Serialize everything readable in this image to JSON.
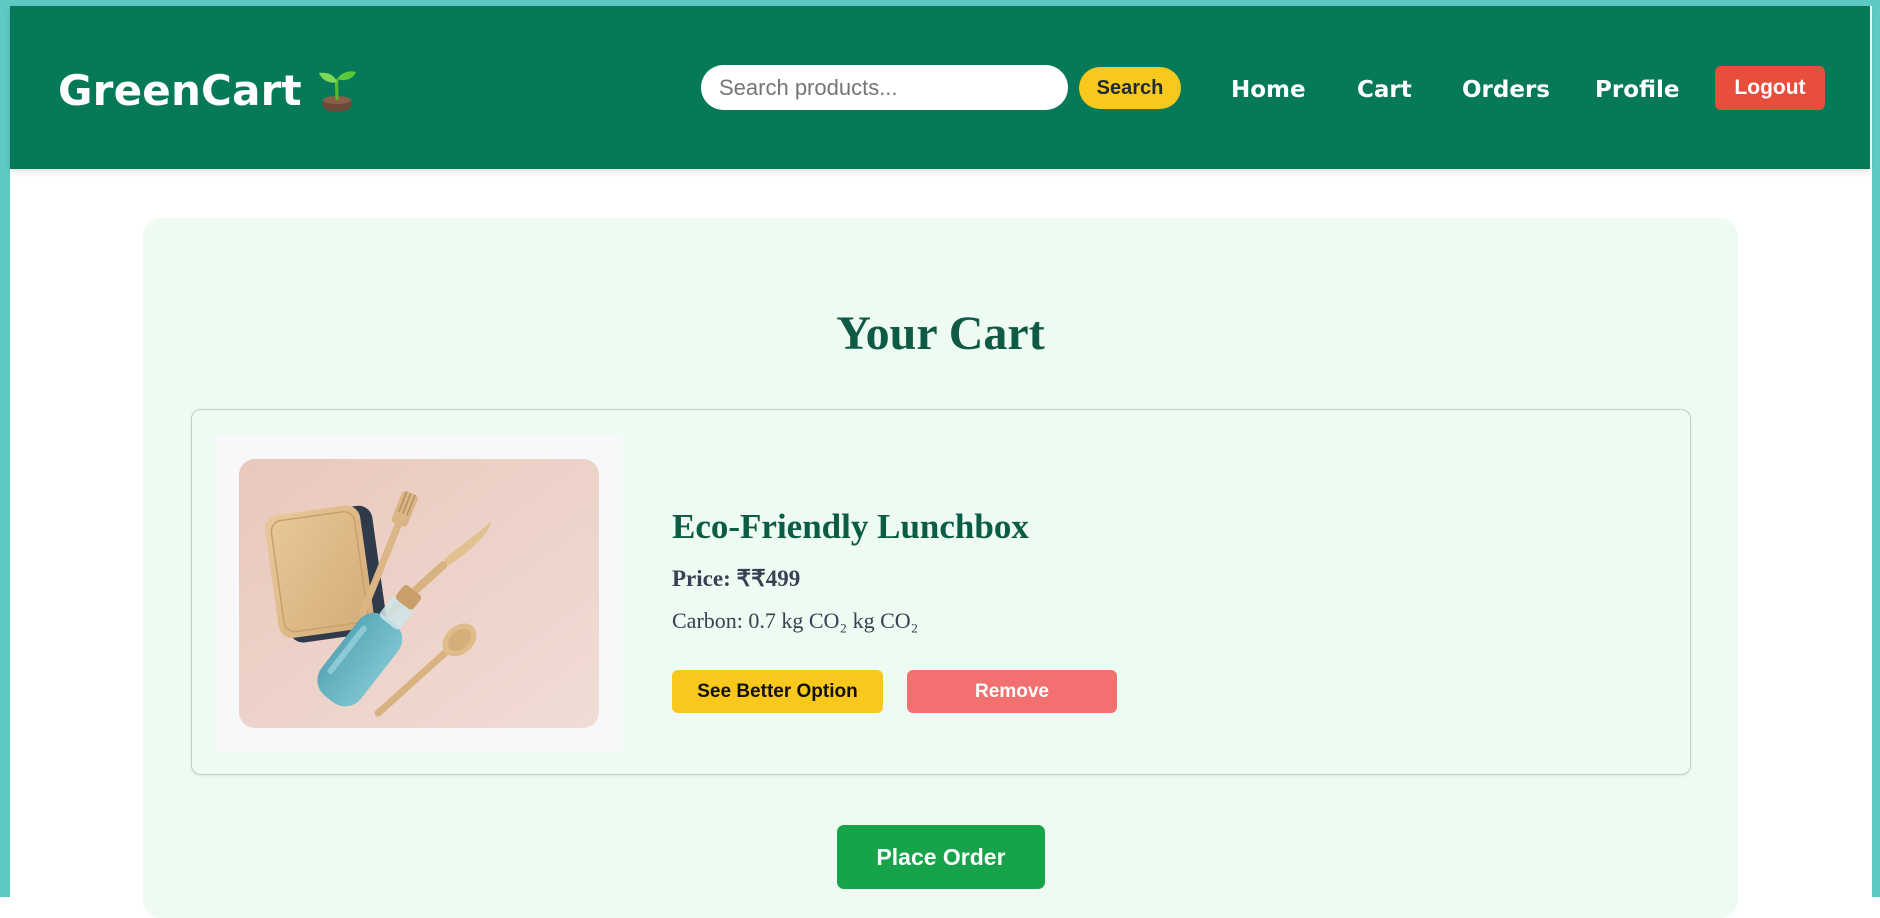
{
  "brand": {
    "name": "GreenCart",
    "logo_icon": "sprout-icon"
  },
  "search": {
    "placeholder": "Search products...",
    "value": "",
    "button_label": "Search"
  },
  "nav": {
    "links": [
      {
        "label": "Home"
      },
      {
        "label": "Cart"
      },
      {
        "label": "Orders"
      },
      {
        "label": "Profile"
      }
    ],
    "logout_label": "Logout"
  },
  "page": {
    "title": "Your Cart"
  },
  "cart": {
    "items": [
      {
        "name": "Eco-Friendly Lunchbox",
        "price_text": "Price: ₹₹499",
        "carbon_text": "Carbon: 0.7 kg CO₂ kg CO₂",
        "image_icon": "lunchbox-photo",
        "better_option_label": "See Better Option",
        "remove_label": "Remove"
      }
    ],
    "place_order_label": "Place Order"
  },
  "colors": {
    "navbar": "#067a58",
    "search_button": "#f8c81d",
    "logout_button": "#e84e3c",
    "panel_background": "#edfbf2",
    "title_text": "#0f5a44",
    "remove_button": "#f27070",
    "place_order_button": "#17a34a"
  }
}
